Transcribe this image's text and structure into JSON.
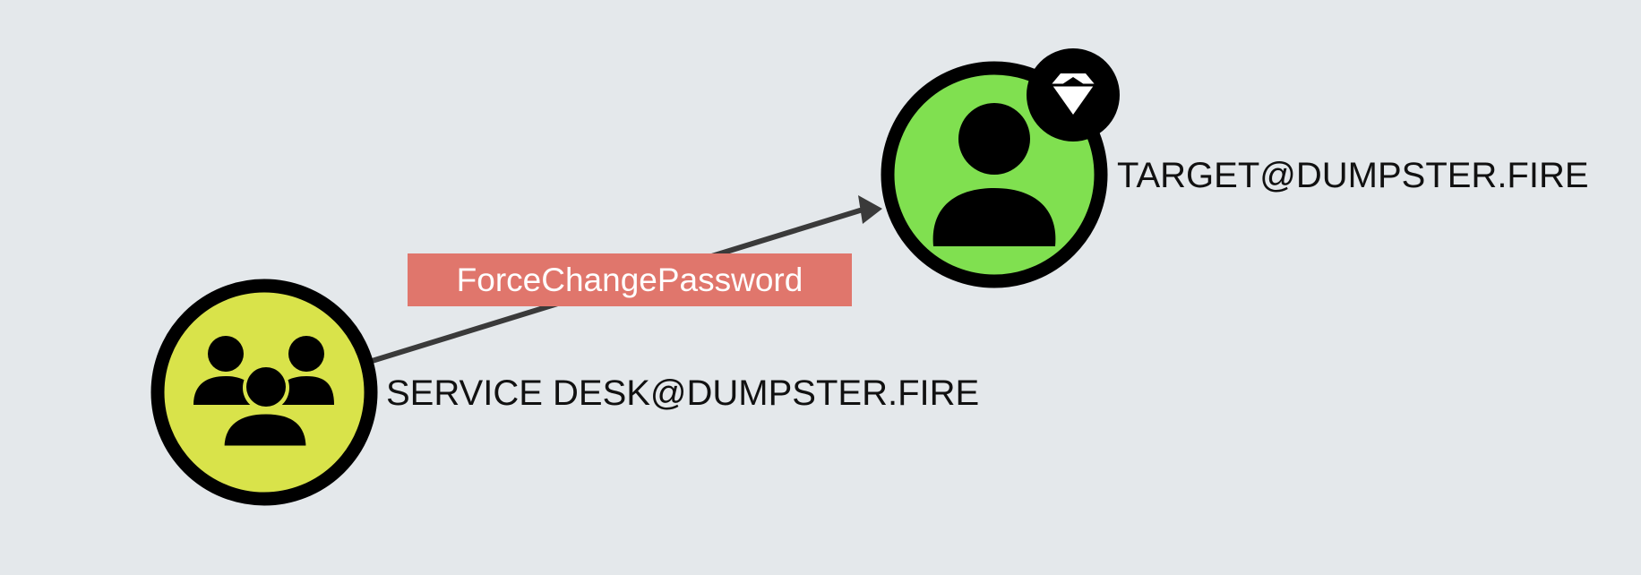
{
  "graph": {
    "source_node": {
      "label": "SERVICE DESK@DUMPSTER.FIRE",
      "kind": "group",
      "fill_color": "#d9e34a",
      "icon": "users-group-icon"
    },
    "target_node": {
      "label": "TARGET@DUMPSTER.FIRE",
      "kind": "user",
      "fill_color": "#80e050",
      "icon": "user-icon",
      "badge_icon": "diamond-gem-icon"
    },
    "edge": {
      "label": "ForceChangePassword",
      "label_bg_color": "#e0766c",
      "line_color": "#3a3a3a"
    }
  }
}
